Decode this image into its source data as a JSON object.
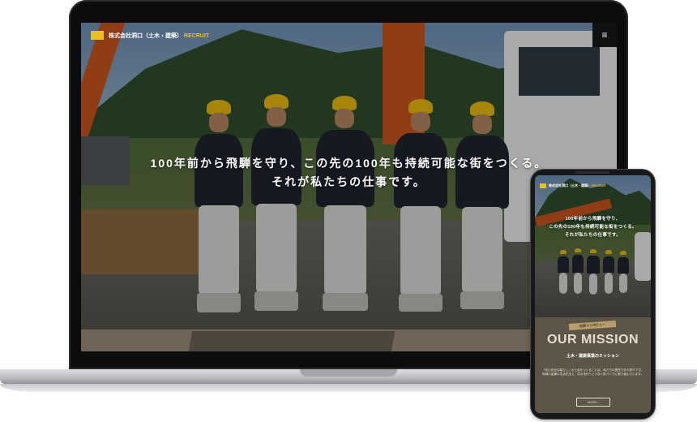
{
  "site": {
    "company": "株式会社洞口（土木・建築）",
    "recruit": "RECRUIT",
    "menu_icon": "≡"
  },
  "hero": {
    "line1": "100年前から飛騨を守り、この先の100年も持続可能な街をつくる。",
    "line2": "それが私たちの仕事です。"
  },
  "phone": {
    "company": "株式会社洞口（土木・建築）",
    "recruit": "RECRUIT",
    "hero_line1": "100年前から飛騨を守り、",
    "hero_line2": "この先の100年も持続可能な街をつくる。",
    "hero_line3": "それが私たちの仕事です。",
    "tag": "社員インタビュー",
    "mission_title": "OUR MISSION",
    "mission_subtitle": "土木・建築事業のミッション",
    "mission_body": "「安心安全な暮らし」の土台をつくることは、私たちの責任であり誇りです。地域の皆様の生活を支え、次の世代へとつなぐ街づくりに取り組んでいます。",
    "more_button": "MORE ›"
  },
  "colors": {
    "accent": "#e8c21b",
    "laptop_bezel": "#0c0c0d",
    "mission_bg": "#5e5549"
  }
}
